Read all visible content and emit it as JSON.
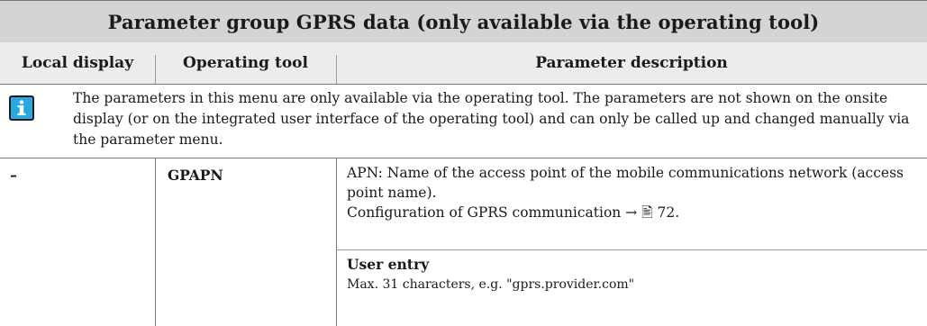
{
  "table": {
    "title": "Parameter group GPRS data (only available via the operating tool)",
    "headers": [
      "Local display",
      "Operating tool",
      "Parameter description"
    ],
    "note": {
      "icon": "info-icon",
      "icon_color": "#29a8e0",
      "text": "The parameters in this menu are only available via the operating tool. The parameters are not shown on the onsite display (or on the integrated user interface of the operating tool) and can only be called up and changed manually via the parameter menu."
    },
    "rows": [
      {
        "local_display": "–",
        "operating_tool": "GPAPN",
        "description_line1": "APN: Name of the access point of the mobile communications network (access point name).",
        "description_line2": "Configuration of GPRS communication → 🖹 72.",
        "user_entry_label": "User entry",
        "user_entry_value": "Max. 31 characters, e.g. \"gprs.provider.com\""
      }
    ]
  }
}
